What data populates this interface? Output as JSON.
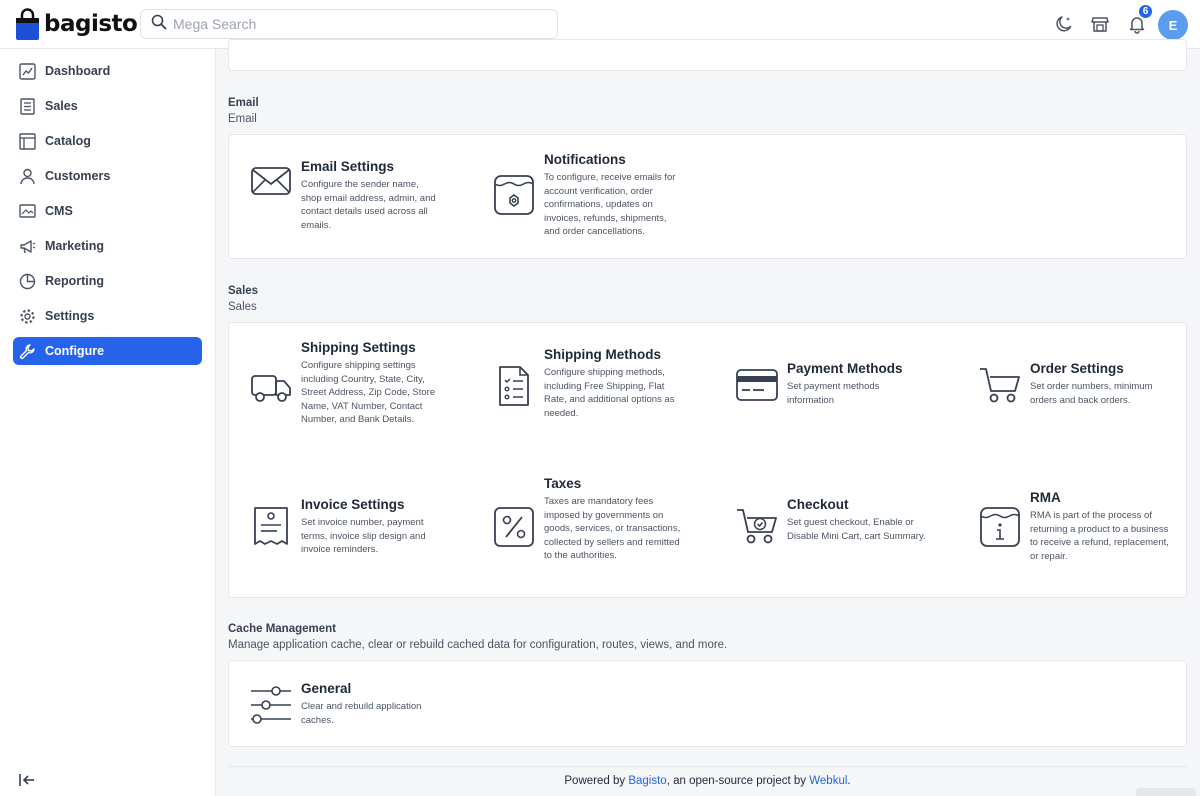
{
  "header": {
    "brand": "bagisto",
    "search_placeholder": "Mega Search",
    "notification_count": "6",
    "avatar_initial": "E"
  },
  "sidebar": {
    "items": [
      {
        "label": "Dashboard",
        "icon": "dashboard-icon"
      },
      {
        "label": "Sales",
        "icon": "sales-icon"
      },
      {
        "label": "Catalog",
        "icon": "catalog-icon"
      },
      {
        "label": "Customers",
        "icon": "customers-icon"
      },
      {
        "label": "CMS",
        "icon": "cms-icon"
      },
      {
        "label": "Marketing",
        "icon": "marketing-icon"
      },
      {
        "label": "Reporting",
        "icon": "reporting-icon"
      },
      {
        "label": "Settings",
        "icon": "settings-icon"
      },
      {
        "label": "Configure",
        "icon": "configure-icon",
        "active": true
      }
    ]
  },
  "sections": {
    "email": {
      "title": "Email",
      "subtitle": "Email",
      "items": [
        {
          "title": "Email Settings",
          "desc": "Configure the sender name, shop email address, admin, and contact details used across all emails.",
          "icon": "envelope-icon"
        },
        {
          "title": "Notifications",
          "desc": "To configure, receive emails for account verification, order confirmations, updates on invoices, refunds, shipments, and order cancellations.",
          "icon": "notification-settings-icon"
        }
      ]
    },
    "sales": {
      "title": "Sales",
      "subtitle": "Sales",
      "items": [
        {
          "title": "Shipping Settings",
          "desc": "Configure shipping settings including Country, State, City, Street Address, Zip Code, Store Name, VAT Number, Contact Number, and Bank Details.",
          "icon": "truck-icon"
        },
        {
          "title": "Shipping Methods",
          "desc": "Configure shipping methods, including Free Shipping, Flat Rate, and additional options as needed.",
          "icon": "checklist-icon"
        },
        {
          "title": "Payment Methods",
          "desc": "Set payment methods information",
          "icon": "credit-card-icon"
        },
        {
          "title": "Order Settings",
          "desc": "Set order numbers, minimum orders and back orders.",
          "icon": "cart-icon"
        },
        {
          "title": "Invoice Settings",
          "desc": "Set invoice number, payment terms, invoice slip design and invoice reminders.",
          "icon": "invoice-icon"
        },
        {
          "title": "Taxes",
          "desc": "Taxes are mandatory fees imposed by governments on goods, services, or transactions, collected by sellers and remitted to the authorities.",
          "icon": "percent-icon"
        },
        {
          "title": "Checkout",
          "desc": "Set guest checkout, Enable or Disable Mini Cart, cart Summary.",
          "icon": "checkout-cart-icon"
        },
        {
          "title": "RMA",
          "desc": "RMA is part of the process of returning a product to a business to receive a refund, replacement, or repair.",
          "icon": "rma-info-icon"
        }
      ]
    },
    "cache": {
      "title": "Cache Management",
      "subtitle": "Manage application cache, clear or rebuild cached data for configuration, routes, views, and more.",
      "items": [
        {
          "title": "General",
          "desc": "Clear and rebuild application caches.",
          "icon": "sliders-icon"
        }
      ]
    }
  },
  "footer": {
    "prefix": "Powered by ",
    "link1": "Bagisto",
    "middle": ", an open-source project by ",
    "link2": "Webkul",
    "suffix": "."
  },
  "colors": {
    "accent": "#2563eb",
    "avatar": "#5b9bf0"
  }
}
